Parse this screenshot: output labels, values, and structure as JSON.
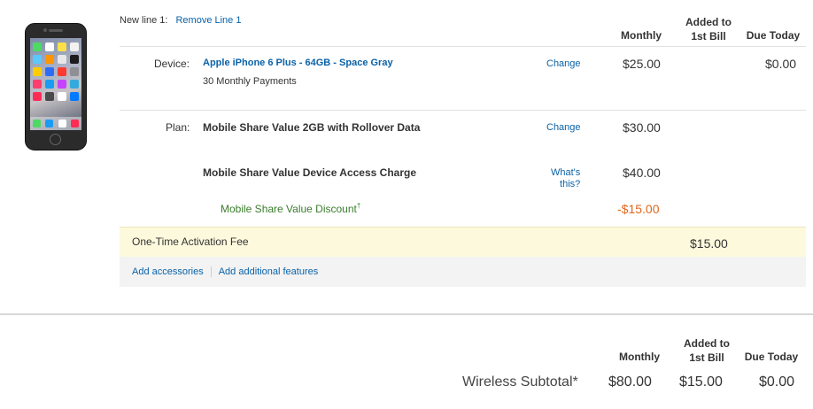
{
  "line": {
    "label": "New line 1:",
    "remove_link": "Remove Line 1"
  },
  "columns": {
    "monthly": "Monthly",
    "added": [
      "Added to",
      "1st Bill"
    ],
    "due_today": "Due Today"
  },
  "device": {
    "label": "Device:",
    "name": "Apple iPhone 6 Plus - 64GB - Space Gray",
    "payments": "30 Monthly Payments",
    "change": "Change",
    "monthly": "$25.00",
    "due_today": "$0.00"
  },
  "plan": {
    "label": "Plan:",
    "name": "Mobile Share Value 2GB with Rollover Data",
    "change": "Change",
    "monthly": "$30.00"
  },
  "access_charge": {
    "name": "Mobile Share Value Device Access Charge",
    "whats_this": [
      "What's",
      "this?"
    ],
    "monthly": "$40.00"
  },
  "discount": {
    "name": "Mobile Share Value Discount",
    "dagger": "†",
    "monthly": "-$15.00"
  },
  "activation": {
    "name": "One-Time Activation Fee",
    "added": "$15.00"
  },
  "links": {
    "accessories": "Add accessories",
    "features": "Add additional features"
  },
  "summary": {
    "columns": {
      "monthly": "Monthly",
      "added": [
        "Added to",
        "1st Bill"
      ],
      "due_today": "Due Today"
    },
    "label": "Wireless Subtotal*",
    "monthly": "$80.00",
    "added": "$15.00",
    "due_today": "$0.00"
  }
}
